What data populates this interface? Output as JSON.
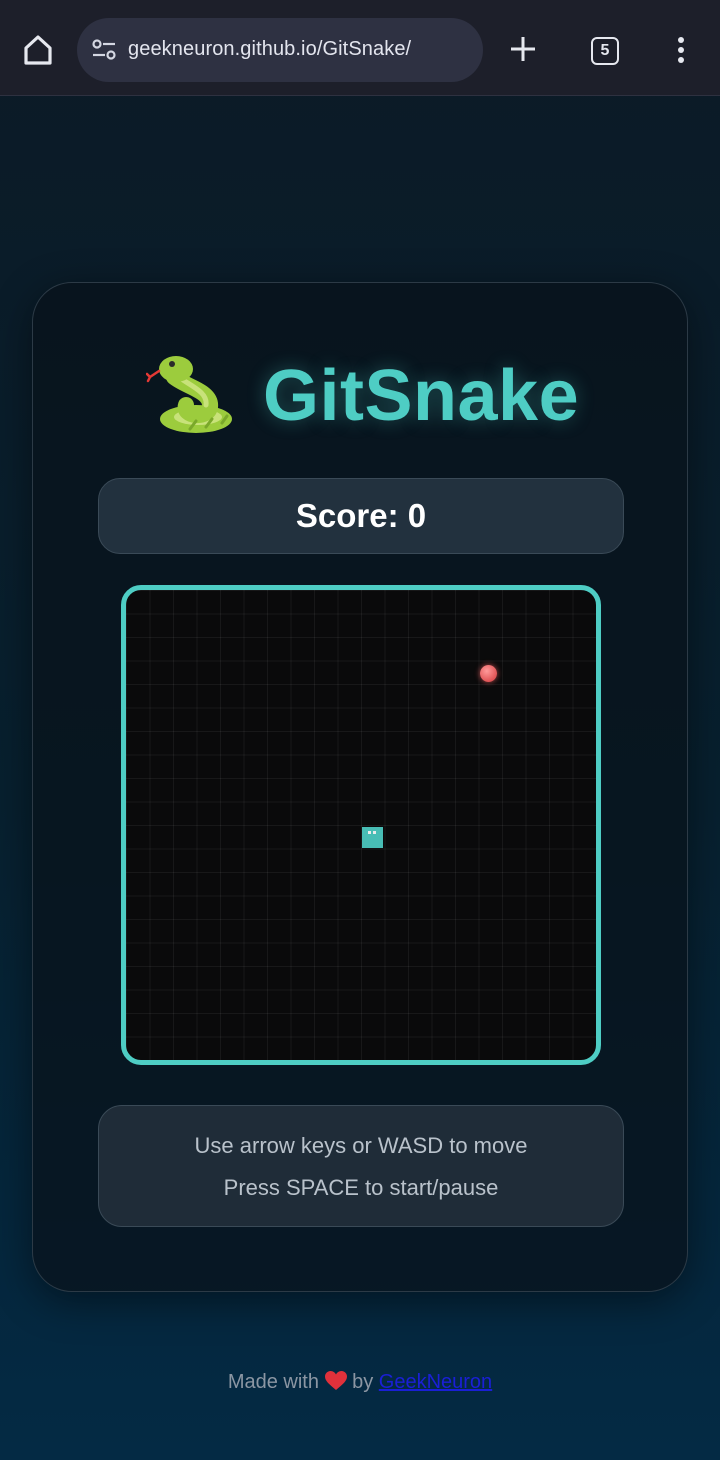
{
  "browser": {
    "url": "geekneuron.github.io/GitSnake/",
    "tab_count": "5",
    "icons": {
      "home": "home-icon",
      "site_settings": "tune-icon",
      "new_tab": "plus-icon",
      "tabs": "tab-switcher-icon",
      "menu": "kebab-menu-icon"
    }
  },
  "game": {
    "title": "GitSnake",
    "title_icon": "snake-emoji-icon",
    "score_text": "Score: 0",
    "instructions": {
      "line1": "Use arrow keys or WASD to move",
      "line2": "Press SPACE to start/pause"
    },
    "colors": {
      "accent": "#4ecdc4",
      "food": "#e05456",
      "board": "#0a0a0b"
    }
  },
  "footer": {
    "prefix": "Made with",
    "middle": "by",
    "link_text": "GeekNeuron"
  }
}
